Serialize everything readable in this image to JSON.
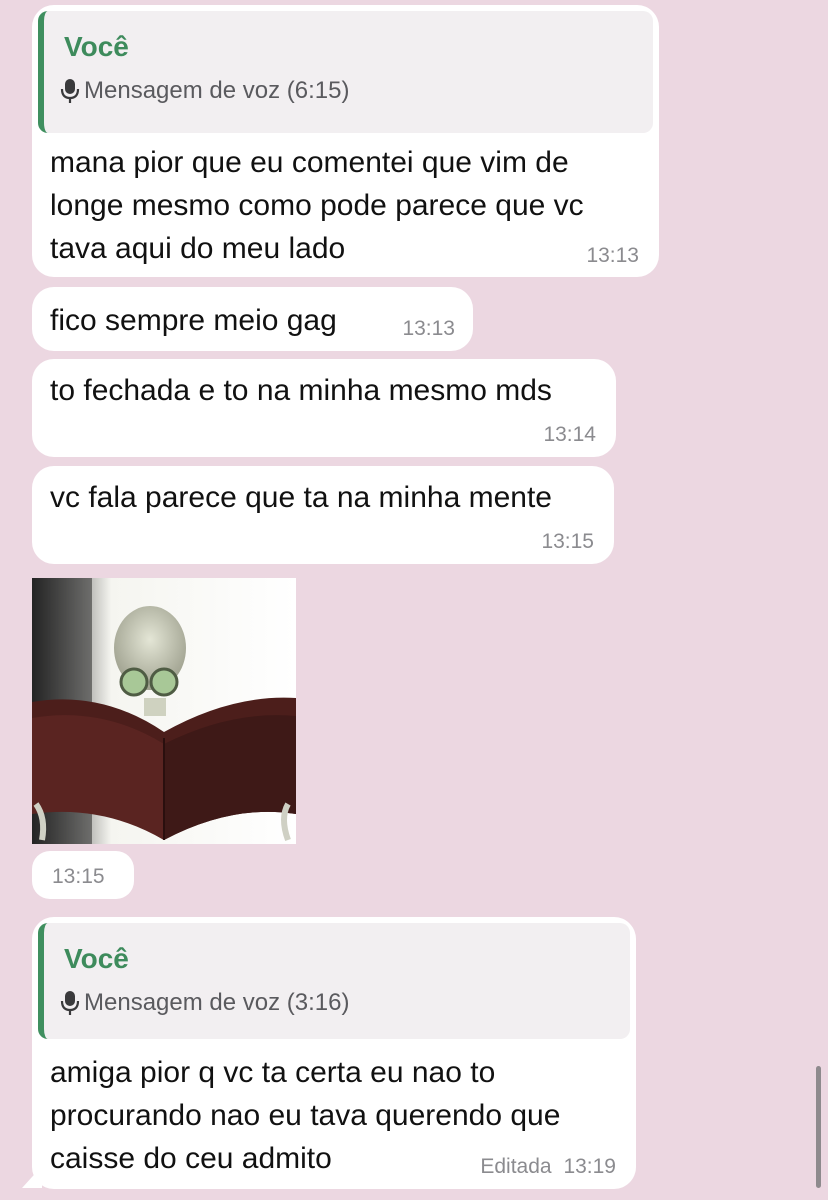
{
  "messages": [
    {
      "quote": {
        "author": "Você",
        "icon": "microphone-icon",
        "text": "Mensagem de voz (6:15)"
      },
      "lines": [
        "mana pior que eu comentei que vim de",
        "longe mesmo como pode parece que vc",
        "tava aqui do meu lado"
      ],
      "time": "13:13"
    },
    {
      "lines": [
        "fico sempre meio gag"
      ],
      "time": "13:13"
    },
    {
      "lines": [
        "to fechada e to na minha mesmo mds"
      ],
      "time": "13:14"
    },
    {
      "lines": [
        "vc fala parece que ta na minha mente"
      ],
      "time": "13:15"
    },
    {
      "sticker": "skeleton-reading-book-sticker",
      "time": "13:15"
    },
    {
      "quote": {
        "author": "Você",
        "icon": "microphone-icon",
        "text": "Mensagem de voz (3:16)"
      },
      "lines": [
        "amiga pior q vc ta certa eu nao to",
        "procurando nao eu tava querendo que",
        "caisse do ceu admito"
      ],
      "edited": "Editada",
      "time": "13:19"
    }
  ],
  "colors": {
    "chat_background": "#ecd7e1",
    "bubble": "#ffffff",
    "quote_background": "#f2eff1",
    "quote_accent": "#3f8f5f",
    "timestamp": "#8b8b8f"
  }
}
